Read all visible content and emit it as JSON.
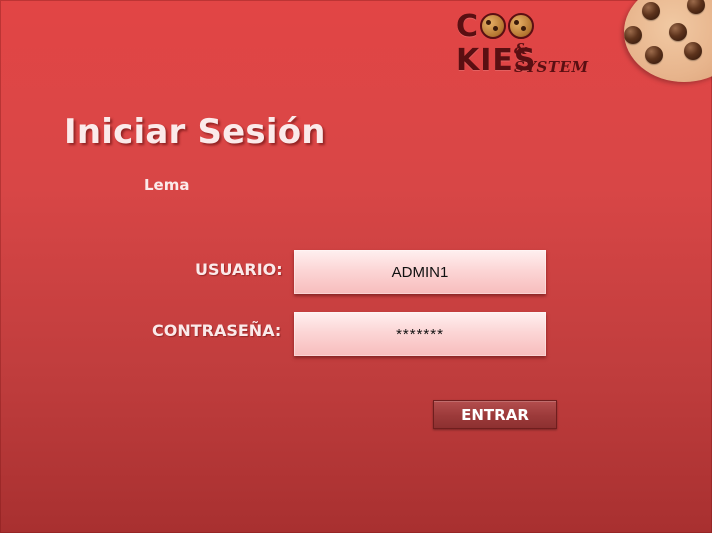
{
  "logo": {
    "prefix": "C",
    "suffix": "KIES",
    "subtitle": "& SYSTEM"
  },
  "login": {
    "title": "Iniciar Sesión",
    "motto": "Lema",
    "username_label": "USUARIO:",
    "username_value": "ADMIN1",
    "password_label": "CONTRASEÑA:",
    "password_value": "*******",
    "submit_label": "ENTRAR"
  },
  "colors": {
    "background_top": "#e24545",
    "background_bottom": "#a83030",
    "field_fill": "#fcd6d6",
    "button_fill": "#9c3a3a",
    "logo_text": "#5a0f12"
  },
  "icons": {
    "logo_mark": "cookie-icon"
  }
}
